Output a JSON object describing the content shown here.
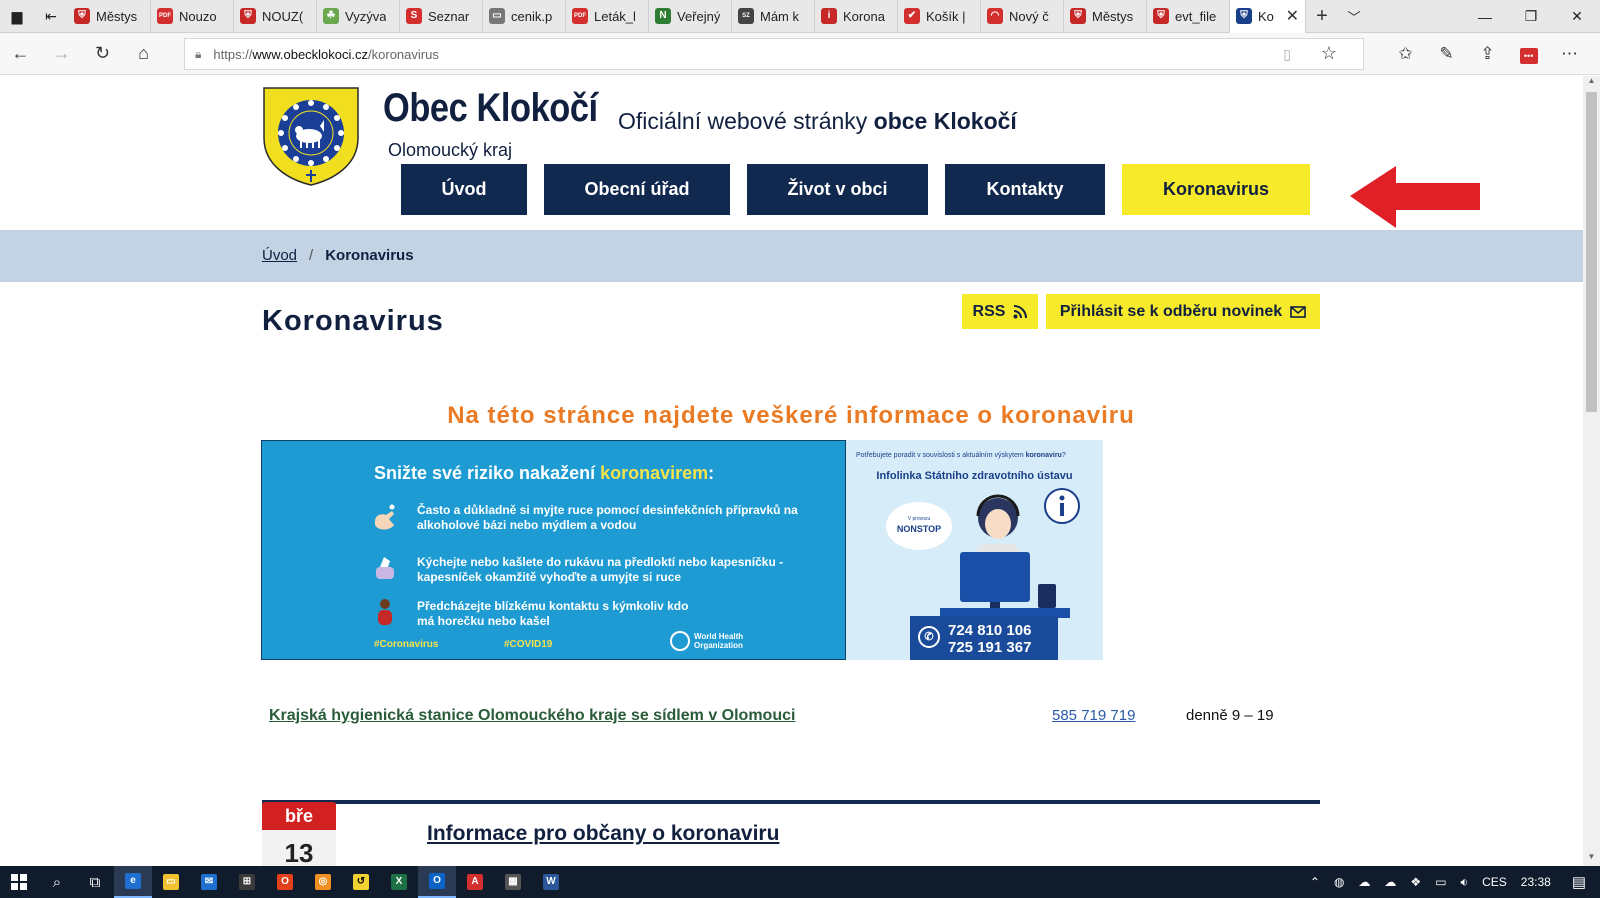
{
  "browser": {
    "tabs": [
      {
        "label": "Městys",
        "fav_color": "#c62828",
        "fav_glyph": "⛨",
        "icon": "shield-favicon"
      },
      {
        "label": "Nouzo",
        "fav_color": "#d32f2f",
        "fav_glyph": "PDF",
        "icon": "pdf-favicon"
      },
      {
        "label": "NOUZ(",
        "fav_color": "#c62828",
        "fav_glyph": "⛨",
        "icon": "shield-favicon"
      },
      {
        "label": "Vyzýva",
        "fav_color": "#6aa84f",
        "fav_glyph": "☘",
        "icon": "leaf-favicon"
      },
      {
        "label": "Seznar",
        "fav_color": "#d32f2f",
        "fav_glyph": "S",
        "icon": "seznam-favicon"
      },
      {
        "label": "cenik.p",
        "fav_color": "#777777",
        "fav_glyph": "▭",
        "icon": "page-favicon"
      },
      {
        "label": "Leták_l",
        "fav_color": "#d32f2f",
        "fav_glyph": "PDF",
        "icon": "pdf-favicon"
      },
      {
        "label": "Veřejný",
        "fav_color": "#2e7d32",
        "fav_glyph": "N",
        "icon": "n-favicon"
      },
      {
        "label": "Mám k",
        "fav_color": "#444444",
        "fav_glyph": "SZ",
        "icon": "sz-favicon"
      },
      {
        "label": "Korona",
        "fav_color": "#c62828",
        "fav_glyph": "i",
        "icon": "info-favicon"
      },
      {
        "label": "Košík |",
        "fav_color": "#d32f2f",
        "fav_glyph": "✔",
        "icon": "check-favicon"
      },
      {
        "label": "Nový č",
        "fav_color": "#d32f2f",
        "fav_glyph": "◠",
        "icon": "arc-favicon"
      },
      {
        "label": "Městys",
        "fav_color": "#c62828",
        "fav_glyph": "⛨",
        "icon": "shield-favicon"
      },
      {
        "label": "evt_file",
        "fav_color": "#c62828",
        "fav_glyph": "⛨",
        "icon": "shield-favicon"
      }
    ],
    "active_tab": {
      "label": "Ko",
      "fav_color": "#1a3f8a",
      "fav_glyph": "⛨",
      "icon": "crest-favicon"
    },
    "url_prefix": "https://",
    "url_host": "www.obecklokoci.cz",
    "url_path": "/koronavirus"
  },
  "header": {
    "site_title": "Obec Klokočí",
    "subtitle_prefix": "Oficiální webové stránky ",
    "subtitle_bold": "obce Klokočí",
    "region": "Olomoucký kraj"
  },
  "mainnav": [
    {
      "label": "Úvod",
      "width": 126
    },
    {
      "label": "Obecní úřad",
      "width": 186
    },
    {
      "label": "Život v obci",
      "width": 181
    },
    {
      "label": "Kontakty",
      "width": 160
    },
    {
      "label": "Koronavirus",
      "width": 188
    }
  ],
  "breadcrumb": {
    "home": "Úvod",
    "separator": "/",
    "current": "Koronavirus"
  },
  "page": {
    "heading": "Koronavirus",
    "rss_label": "RSS",
    "subscribe_label": "Přihlásit se k odběru novinek",
    "intro": "Na této stránce najdete veškeré informace o koronaviru"
  },
  "who_banner": {
    "head_prefix": "Snižte své riziko nakažení ",
    "head_highlight": "koronavirem",
    "head_suffix": ":",
    "rows": [
      "Často a důkladně si myjte ruce pomocí desinfekčních přípravků na alkoholové bázi nebo mýdlem a vodou",
      "Kýchejte nebo kašlete do rukávu na předloktí nebo kapesníčku - kapesníček okamžitě vyhoďte a umyjte si ruce",
      "Předcházejte blízkému kontaktu s kýmkoliv kdo má horečku nebo kašel"
    ],
    "tag1": "#Coronavirus",
    "tag2": "#COVID19",
    "org_line1": "World Health",
    "org_line2": "Organization"
  },
  "szu_banner": {
    "question_prefix": "Potřebujete poradit v souvislosti s aktuálním výskytem ",
    "question_bold": "koronaviru",
    "question_suffix": "?",
    "head": "Infolinka Státního zdravotního ústavu",
    "bubble_small": "V provozu",
    "bubble": "NONSTOP",
    "phone1": "724 810 106",
    "phone2": "725 191 367"
  },
  "khs": {
    "name": "Krajská hygienická stanice Olomouckého kraje se sídlem v Olomouci",
    "phone": "585 719 719",
    "hours": "denně 9 – 19"
  },
  "news": {
    "month": "bře",
    "day": "13",
    "title": "Informace pro občany o koronaviru"
  },
  "taskbar": {
    "lang": "CES",
    "time": "23:38"
  },
  "colors": {
    "navy": "#11284f",
    "yellow": "#f6ea2a",
    "orange": "#ea7b24",
    "crumb_bg": "#c3d3e4",
    "who_blue": "#1e9bd2",
    "annotation_red": "#e01f26"
  }
}
